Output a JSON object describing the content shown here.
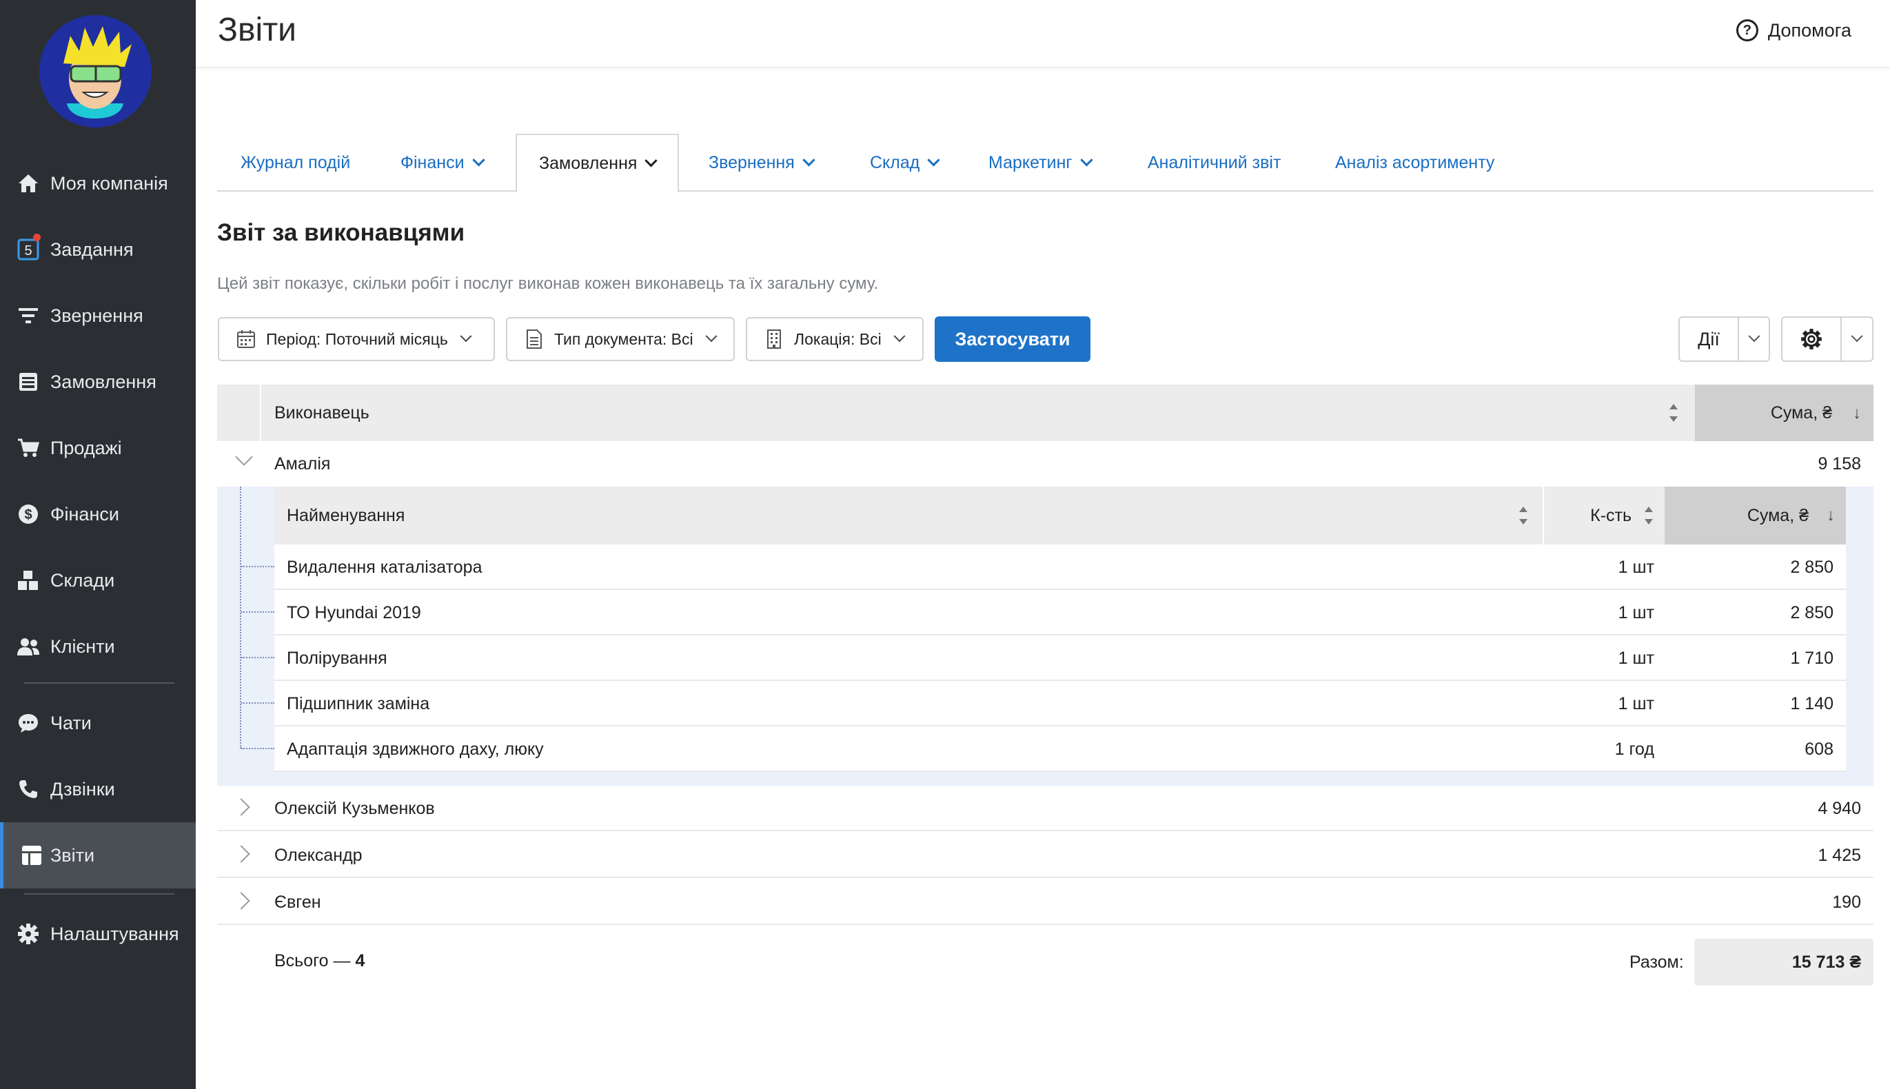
{
  "header": {
    "title": "Звіти",
    "help_label": "Допомога"
  },
  "sidebar": {
    "items": [
      {
        "label": "Моя компанія",
        "icon": "home-icon"
      },
      {
        "label": "Завдання",
        "icon": "tasks-icon",
        "badge": "5"
      },
      {
        "label": "Звернення",
        "icon": "funnel-icon"
      },
      {
        "label": "Замовлення",
        "icon": "orders-icon"
      },
      {
        "label": "Продажі",
        "icon": "cart-icon"
      },
      {
        "label": "Фінанси",
        "icon": "dollar-icon"
      },
      {
        "label": "Склади",
        "icon": "boxes-icon"
      },
      {
        "label": "Клієнти",
        "icon": "users-icon"
      },
      {
        "label": "Чати",
        "icon": "chat-icon"
      },
      {
        "label": "Дзвінки",
        "icon": "phone-icon"
      },
      {
        "label": "Звіти",
        "icon": "reports-icon",
        "active": true
      },
      {
        "label": "Налаштування",
        "icon": "gear-icon"
      }
    ]
  },
  "tabs": [
    {
      "label": "Журнал подій"
    },
    {
      "label": "Фінанси"
    },
    {
      "label": "Замовлення",
      "active": true
    },
    {
      "label": "Звернення"
    },
    {
      "label": "Склад"
    },
    {
      "label": "Маркетинг"
    },
    {
      "label": "Аналітичний звіт"
    },
    {
      "label": "Аналіз асортименту"
    }
  ],
  "report": {
    "title": "Звіт за виконавцями",
    "description": "Цей звіт показує, скільки робіт і послуг виконав кожен виконавець та їх загальну суму."
  },
  "filters": {
    "period": "Період: Поточний місяць",
    "doc_type": "Тип документа: Всі",
    "location": "Локація: Всі",
    "apply": "Застосувати",
    "actions": "Дії"
  },
  "table": {
    "col_executor": "Виконавець",
    "col_sum": "Сума, ₴",
    "rows": [
      {
        "name": "Амалія",
        "sum": "9 158",
        "expanded": true
      },
      {
        "name": "Олексій Кузьменков",
        "sum": "4 940"
      },
      {
        "name": "Олександр",
        "sum": "1 425"
      },
      {
        "name": "Євген",
        "sum": "190"
      }
    ]
  },
  "subtable": {
    "col_name": "Найменування",
    "col_qty": "К-сть",
    "col_sum": "Сума, ₴",
    "rows": [
      {
        "name": "Видалення каталізатора",
        "qty": "1 шт",
        "sum": "2 850"
      },
      {
        "name": "ТО Hyundai 2019",
        "qty": "1 шт",
        "sum": "2 850"
      },
      {
        "name": "Полірування",
        "qty": "1 шт",
        "sum": "1 710"
      },
      {
        "name": "Підшипник заміна",
        "qty": "1 шт",
        "sum": "1 140"
      },
      {
        "name": "Адаптація здвижного даху, люку",
        "qty": "1 год",
        "sum": "608"
      }
    ]
  },
  "footer": {
    "total_prefix": "Всього — ",
    "total_count": "4",
    "total_label": "Разом:",
    "total_value": "15 713 ₴"
  },
  "colors": {
    "sidebar_bg": "#2b2f33",
    "accent": "#1e73c8",
    "link": "#1a6ec2",
    "badge": "#e8443a"
  }
}
